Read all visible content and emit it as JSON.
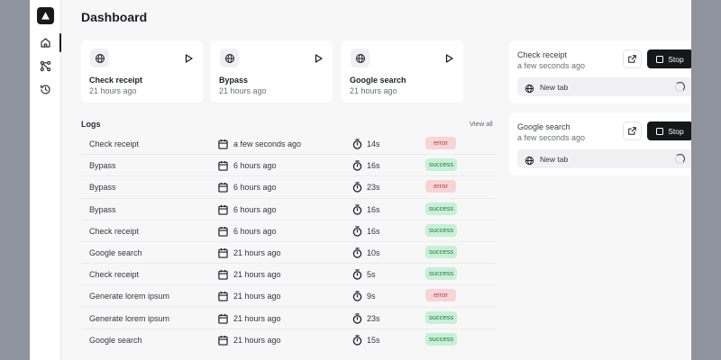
{
  "page": {
    "title": "Dashboard"
  },
  "nav": {
    "items": [
      {
        "icon": "home-icon",
        "active": true
      },
      {
        "icon": "workflow-icon",
        "active": false
      },
      {
        "icon": "history-icon",
        "active": false
      }
    ]
  },
  "tasks": [
    {
      "name": "Check receipt",
      "time": "21 hours ago"
    },
    {
      "name": "Bypass",
      "time": "21 hours ago"
    },
    {
      "name": "Google search",
      "time": "21 hours ago"
    }
  ],
  "logs": {
    "title": "Logs",
    "view_all": "View all",
    "rows": [
      {
        "name": "Check receipt",
        "when": "a few seconds ago",
        "duration": "14s",
        "status": "error"
      },
      {
        "name": "Bypass",
        "when": "6 hours ago",
        "duration": "16s",
        "status": "success"
      },
      {
        "name": "Bypass",
        "when": "6 hours ago",
        "duration": "23s",
        "status": "error"
      },
      {
        "name": "Bypass",
        "when": "6 hours ago",
        "duration": "16s",
        "status": "success"
      },
      {
        "name": "Check receipt",
        "when": "6 hours ago",
        "duration": "16s",
        "status": "success"
      },
      {
        "name": "Google search",
        "when": "21 hours ago",
        "duration": "10s",
        "status": "success"
      },
      {
        "name": "Check receipt",
        "when": "21 hours ago",
        "duration": "5s",
        "status": "success"
      },
      {
        "name": "Generate lorem ipsum",
        "when": "21 hours ago",
        "duration": "9s",
        "status": "error"
      },
      {
        "name": "Generate lorem ipsum",
        "when": "21 hours ago",
        "duration": "23s",
        "status": "success"
      },
      {
        "name": "Google search",
        "when": "21 hours ago",
        "duration": "15s",
        "status": "success"
      }
    ]
  },
  "running": [
    {
      "name": "Check receipt",
      "time": "a few seconds ago",
      "stop_label": "Stop",
      "tab_label": "New tab"
    },
    {
      "name": "Google search",
      "time": "a few seconds ago",
      "stop_label": "Stop",
      "tab_label": "New tab"
    }
  ],
  "colors": {
    "error_bg": "#f9d4d6",
    "error_text": "#b53a44",
    "success_bg": "#c8f0d6",
    "success_text": "#217a44",
    "stop_bg": "#16171a"
  }
}
